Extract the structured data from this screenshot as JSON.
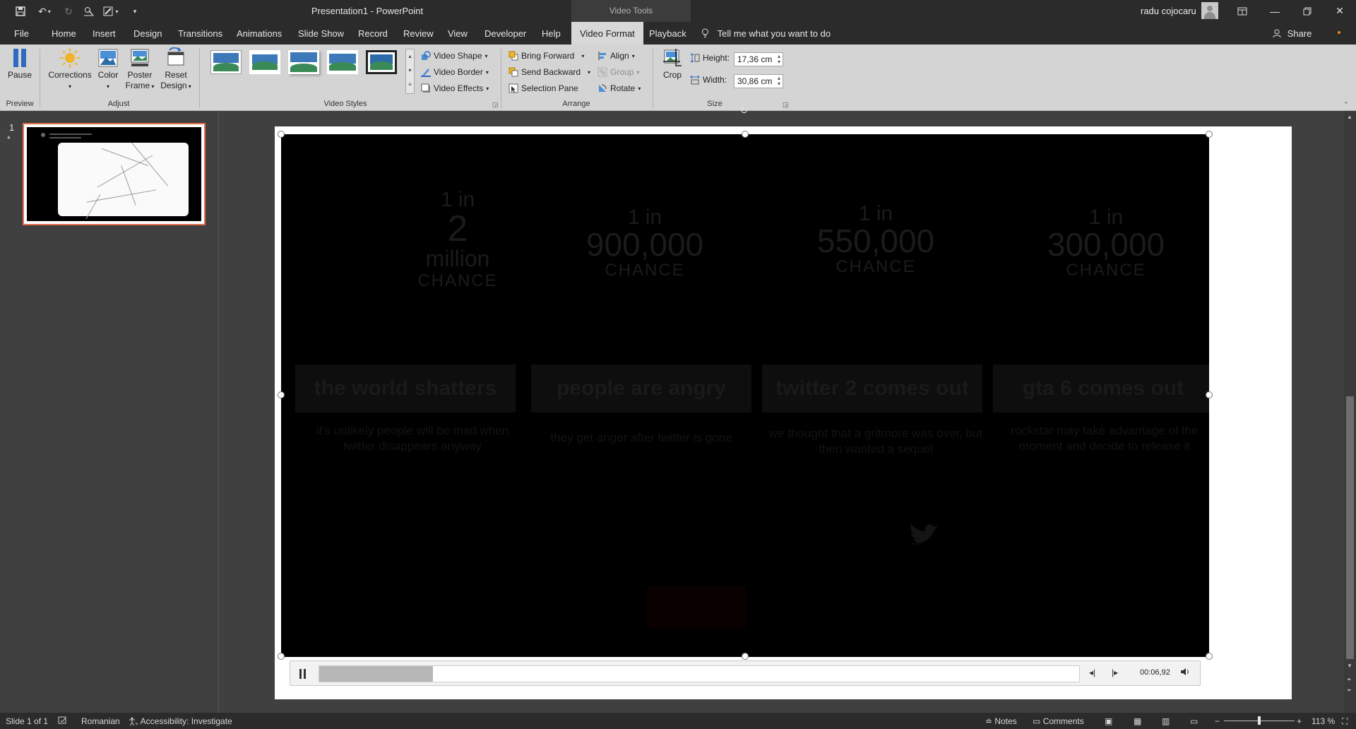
{
  "titlebar": {
    "doc_title": "Presentation1 - PowerPoint",
    "context_tab_group": "Video Tools",
    "user_name": "radu cojocaru",
    "qat_icons": [
      "save-icon",
      "undo-icon",
      "redo-icon",
      "touch-mode-icon",
      "draw-icon",
      "customize-icon"
    ],
    "window_icons": [
      "ribbon-display-icon",
      "minimize-icon",
      "restore-icon",
      "close-icon"
    ]
  },
  "tabs": [
    {
      "label": "File"
    },
    {
      "label": "Home"
    },
    {
      "label": "Insert"
    },
    {
      "label": "Design"
    },
    {
      "label": "Transitions"
    },
    {
      "label": "Animations"
    },
    {
      "label": "Slide Show"
    },
    {
      "label": "Record"
    },
    {
      "label": "Review"
    },
    {
      "label": "View"
    },
    {
      "label": "Developer"
    },
    {
      "label": "Help"
    },
    {
      "label": "Video Format",
      "active": true
    },
    {
      "label": "Playback"
    }
  ],
  "tell_me": "Tell me what you want to do",
  "share": "Share",
  "ribbon": {
    "preview": {
      "label": "Preview",
      "pause": "Pause"
    },
    "adjust": {
      "label": "Adjust",
      "corrections": "Corrections",
      "color": "Color",
      "poster": "Poster",
      "frame": "Frame",
      "reset": "Reset",
      "design": "Design"
    },
    "video_styles": {
      "label": "Video Styles",
      "video_shape": "Video Shape",
      "video_border": "Video Border",
      "video_effects": "Video Effects"
    },
    "arrange": {
      "label": "Arrange",
      "bring_forward": "Bring Forward",
      "send_backward": "Send Backward",
      "selection_pane": "Selection Pane",
      "align": "Align",
      "group": "Group",
      "rotate": "Rotate"
    },
    "size": {
      "label": "Size",
      "crop": "Crop",
      "height_label": "Height:",
      "height_value": "17,36 cm",
      "width_label": "Width:",
      "width_value": "30,86 cm"
    }
  },
  "thumbnails": {
    "slide_number": "1",
    "marker": "*"
  },
  "video_frame": {
    "odds": [
      {
        "a": "1 in",
        "b": "2",
        "c": "million",
        "d": "CHANCE"
      },
      {
        "a": "1 in",
        "b": "900,000",
        "d": "CHANCE"
      },
      {
        "a": "1 in",
        "b": "550,000",
        "d": "CHANCE"
      },
      {
        "a": "1 in",
        "b": "300,000",
        "d": "CHANCE"
      }
    ],
    "cards": [
      "the world shatters",
      "people are angry",
      "twitter 2 comes out",
      "gta 6 comes out"
    ],
    "descriptions": [
      "it's unlikely people will be mad when twitter disappears anyway",
      "they get anger after twitter is gone",
      "we thought that a gritmore was over, but then wanted a sequel",
      "rockstar may take advantage of the moment and decide to release it"
    ]
  },
  "media": {
    "timecode": "00:06,92",
    "progress": 0.15
  },
  "status": {
    "slide_info": "Slide 1 of 1",
    "language": "Romanian",
    "accessibility": "Accessibility: Investigate",
    "notes": "Notes",
    "comments": "Comments",
    "zoom": "113 %"
  }
}
